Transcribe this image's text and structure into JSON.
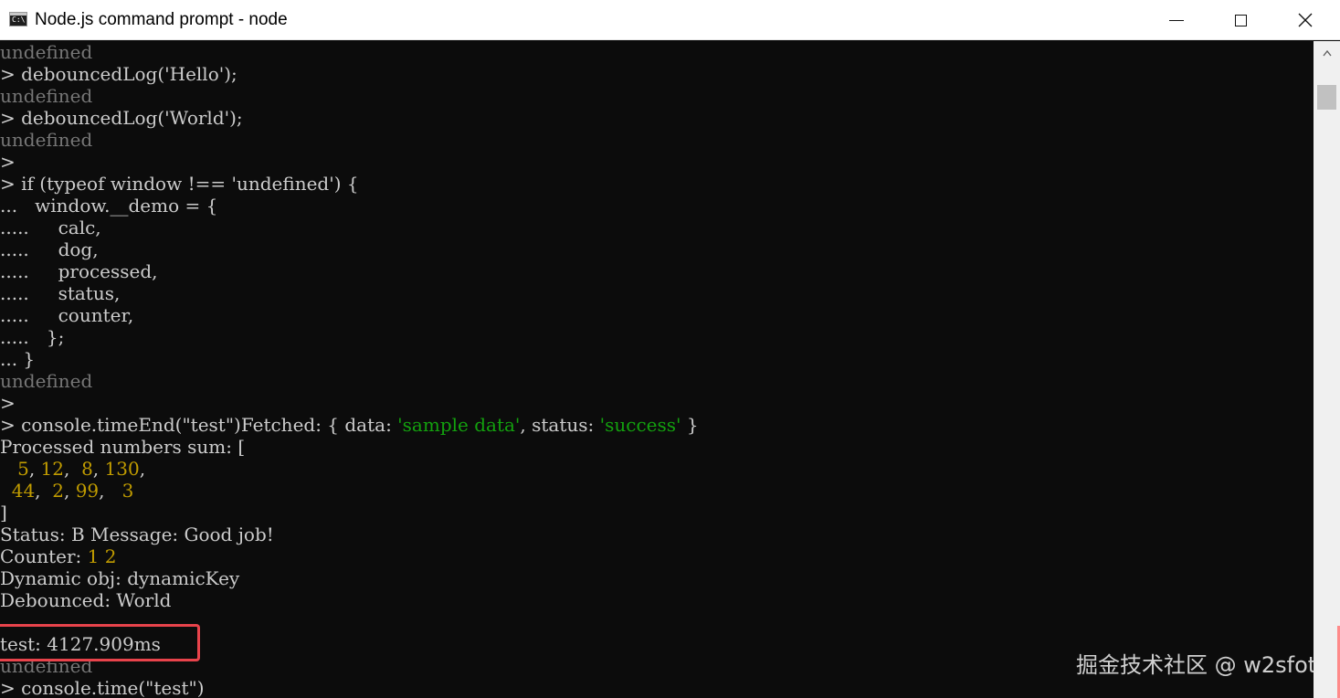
{
  "window": {
    "title": "Node.js command prompt - node",
    "icon": "console-icon",
    "icon_glyph": "C:\\",
    "controls": [
      "minimize-icon",
      "maximize-icon",
      "close-icon"
    ]
  },
  "console": {
    "lines": [
      {
        "cls": "dim",
        "text": "undefined"
      },
      {
        "cls": "prompt",
        "text": "> debouncedLog('Hello');"
      },
      {
        "cls": "dim",
        "text": "undefined"
      },
      {
        "cls": "prompt",
        "text": "> debouncedLog('World');"
      },
      {
        "cls": "dim",
        "text": "undefined"
      },
      {
        "cls": "prompt",
        "text": ">"
      },
      {
        "cls": "prompt",
        "text": "> if (typeof window !== 'undefined') {"
      },
      {
        "cls": "prompt",
        "text": "...   window.__demo = {"
      },
      {
        "cls": "prompt",
        "text": ".....     calc,"
      },
      {
        "cls": "prompt",
        "text": ".....     dog,"
      },
      {
        "cls": "prompt",
        "text": ".....     processed,"
      },
      {
        "cls": "prompt",
        "text": ".....     status,"
      },
      {
        "cls": "prompt",
        "text": ".....     counter,"
      },
      {
        "cls": "prompt",
        "text": ".....   };"
      },
      {
        "cls": "prompt",
        "text": "... }"
      },
      {
        "cls": "dim",
        "text": "undefined"
      },
      {
        "cls": "prompt",
        "text": ">"
      },
      {
        "segments": [
          {
            "cls": "",
            "text": "> console.timeEnd(\"test\")Fetched: { data: "
          },
          {
            "cls": "str",
            "text": "'sample data'"
          },
          {
            "cls": "",
            "text": ", status: "
          },
          {
            "cls": "str",
            "text": "'success'"
          },
          {
            "cls": "",
            "text": " }"
          }
        ]
      },
      {
        "cls": "",
        "text": "Processed numbers sum: ["
      },
      {
        "segments": [
          {
            "cls": "",
            "text": "   "
          },
          {
            "cls": "num",
            "text": "5"
          },
          {
            "cls": "",
            "text": ", "
          },
          {
            "cls": "num",
            "text": "12"
          },
          {
            "cls": "",
            "text": ",  "
          },
          {
            "cls": "num",
            "text": "8"
          },
          {
            "cls": "",
            "text": ", "
          },
          {
            "cls": "num",
            "text": "130"
          },
          {
            "cls": "",
            "text": ","
          }
        ]
      },
      {
        "segments": [
          {
            "cls": "",
            "text": "  "
          },
          {
            "cls": "num",
            "text": "44"
          },
          {
            "cls": "",
            "text": ",  "
          },
          {
            "cls": "num",
            "text": "2"
          },
          {
            "cls": "",
            "text": ", "
          },
          {
            "cls": "num",
            "text": "99"
          },
          {
            "cls": "",
            "text": ",   "
          },
          {
            "cls": "num",
            "text": "3"
          }
        ]
      },
      {
        "cls": "",
        "text": "]"
      },
      {
        "cls": "",
        "text": "Status: B Message: Good job!"
      },
      {
        "segments": [
          {
            "cls": "",
            "text": "Counter: "
          },
          {
            "cls": "num",
            "text": "1"
          },
          {
            "cls": "",
            "text": " "
          },
          {
            "cls": "num",
            "text": "2"
          }
        ]
      },
      {
        "cls": "",
        "text": "Dynamic obj: dynamicKey"
      },
      {
        "cls": "",
        "text": "Debounced: World"
      },
      {
        "cls": "",
        "text": ""
      },
      {
        "cls": "",
        "text": "test: 4127.909ms"
      },
      {
        "cls": "dim",
        "text": "undefined"
      },
      {
        "cls": "prompt",
        "text": "> console.time(\"test\")"
      }
    ]
  },
  "watermark": "掘金技术社区 @ w2sfot",
  "colors": {
    "background": "#0c0c0c",
    "text": "#cccccc",
    "dim": "#767676",
    "string": "#13a10e",
    "number": "#c19c00",
    "highlight": "#e8434b"
  }
}
